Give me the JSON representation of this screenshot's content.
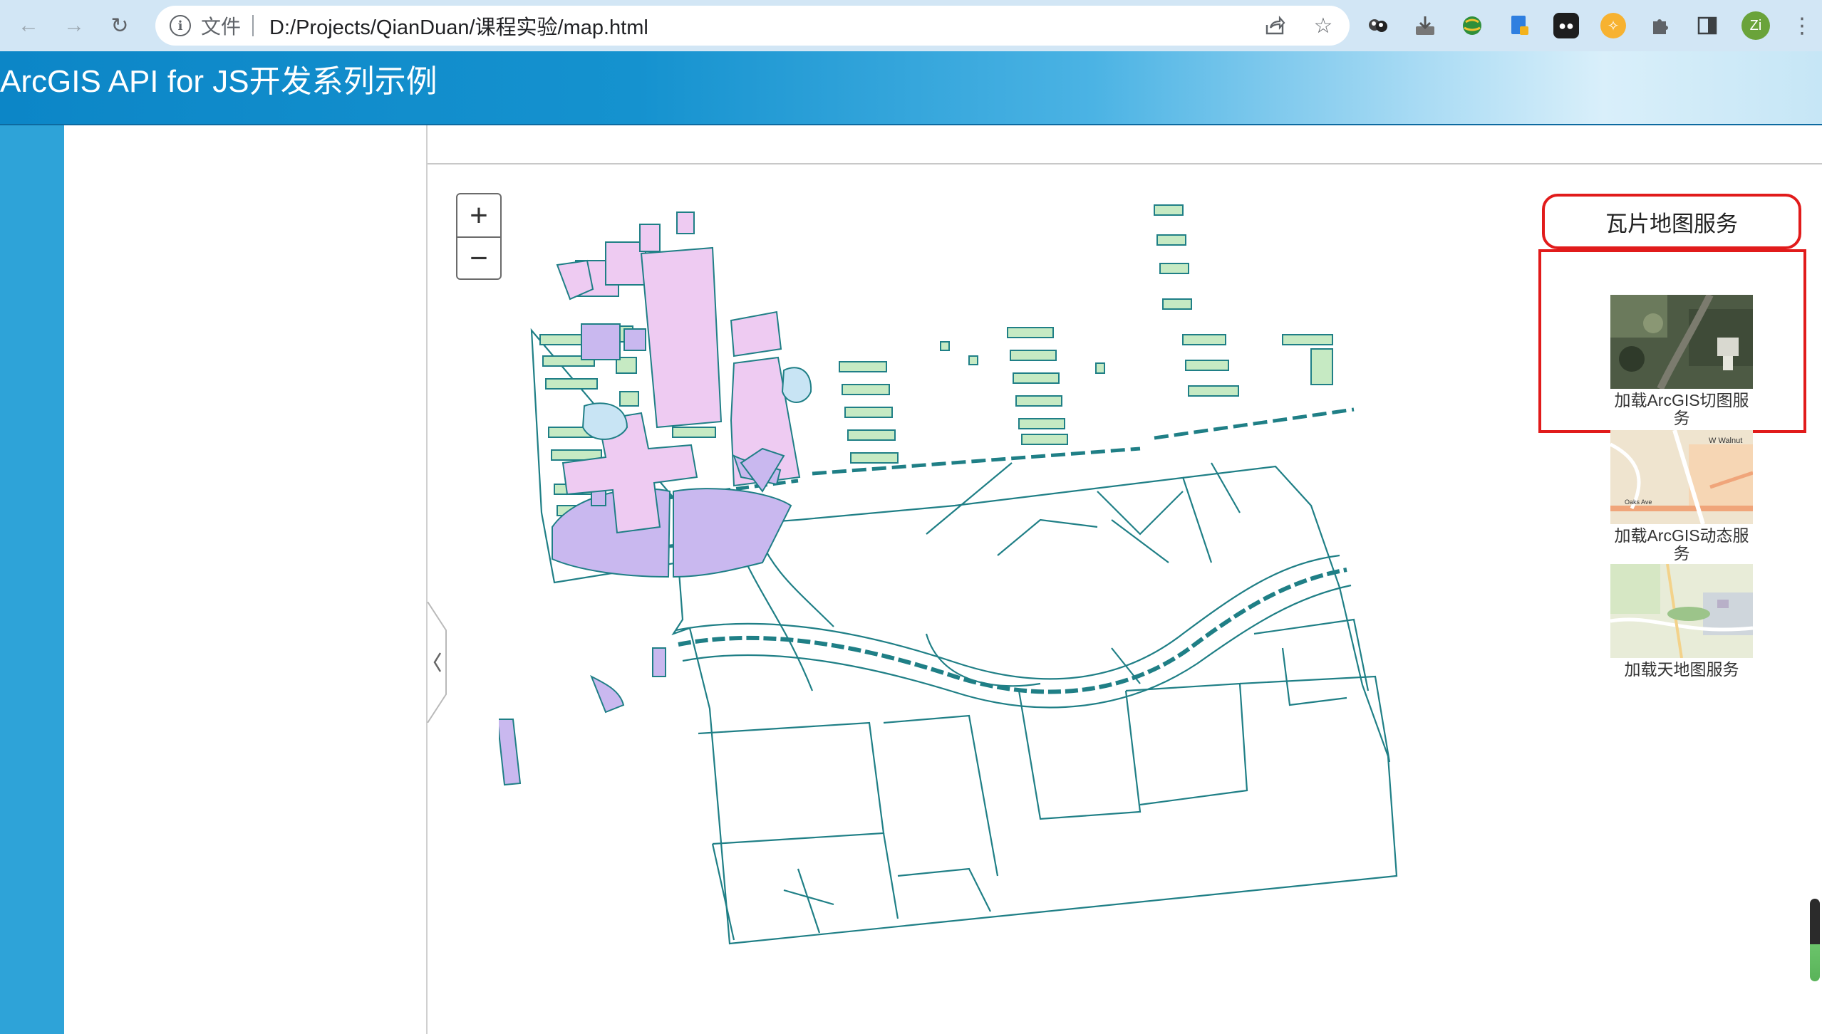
{
  "browser": {
    "url_scheme": "文件",
    "url": "D:/Projects/QianDuan/课程实验/map.html",
    "profile_initial": "Zi"
  },
  "header": {
    "title": "ArcGIS API for JS开发系列示例"
  },
  "map": {
    "zoom_in_label": "+",
    "zoom_out_label": "−",
    "colors": {
      "outline": "#1f7f86",
      "building_green": "#c6eac3",
      "building_pink": "#eecbf2",
      "building_violet": "#c9b8ef",
      "water_blue": "#c8e4f4"
    }
  },
  "basemap_panel": {
    "title": "瓦片地图服务",
    "items": [
      {
        "label": "加载ArcGIS切图服务",
        "thumb": "imagery"
      },
      {
        "label": "加载ArcGIS动态服务",
        "thumb": "streets",
        "street_labels": [
          "W Walnut",
          "Oaks Ave"
        ]
      },
      {
        "label": "加载天地图服务",
        "thumb": "topo"
      }
    ]
  },
  "colors": {
    "highlight": "#e11b1b",
    "rail": "#2ea3d8",
    "header_start": "#0c86c7"
  }
}
